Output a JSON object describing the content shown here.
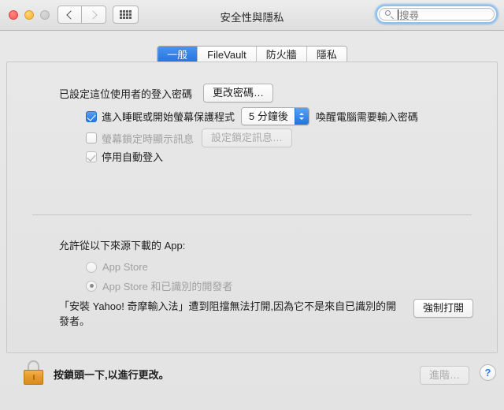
{
  "window": {
    "title": "安全性與隱私",
    "traffic_lights": [
      "close",
      "minimize",
      "zoom"
    ],
    "nav": {
      "back_icon": "chevron-left-icon",
      "forward_icon": "chevron-right-icon",
      "grid_icon": "grid-dots-icon"
    },
    "search": {
      "placeholder": "搜尋",
      "value": "",
      "icon": "search-icon",
      "focused": true
    }
  },
  "tabs": [
    {
      "label": "一般",
      "active": true
    },
    {
      "label": "FileVault",
      "active": false
    },
    {
      "label": "防火牆",
      "active": false
    },
    {
      "label": "隱私",
      "active": false
    }
  ],
  "general": {
    "password_label": "已設定這位使用者的登入密碼",
    "change_password_button": "更改密碼…",
    "require_password": {
      "checked": true,
      "label_before": "進入睡眠或開始螢幕保護程式",
      "delay_value": "5 分鐘後",
      "label_after": "喚醒電腦需要輸入密碼"
    },
    "screen_lock_message": {
      "checked": false,
      "enabled": false,
      "label": "螢幕鎖定時顯示訊息",
      "set_message_button": "設定鎖定訊息…"
    },
    "disable_auto_login": {
      "checked": true,
      "enabled": false,
      "label": "停用自動登入"
    }
  },
  "app_sources": {
    "title": "允許從以下來源下載的 App:",
    "options": [
      {
        "label": "App Store",
        "selected": false,
        "enabled": false
      },
      {
        "label": "App Store 和已識別的開發者",
        "selected": true,
        "enabled": false
      }
    ],
    "blocked_message": "「安裝 Yahoo! 奇摩輸入法」遭到阻擋無法打開,因為它不是來自已識別的開發者。",
    "open_anyway_button": "強制打開"
  },
  "footer": {
    "lock_icon": "lock-closed-icon",
    "lock_hint": "按鎖頭一下,以進行更改。",
    "advanced_button": "進階…",
    "help_button": "?"
  },
  "colors": {
    "accent_blue": "#2277e4",
    "lock_gold": "#e89b2b",
    "help_blue": "#2f7ee0"
  }
}
